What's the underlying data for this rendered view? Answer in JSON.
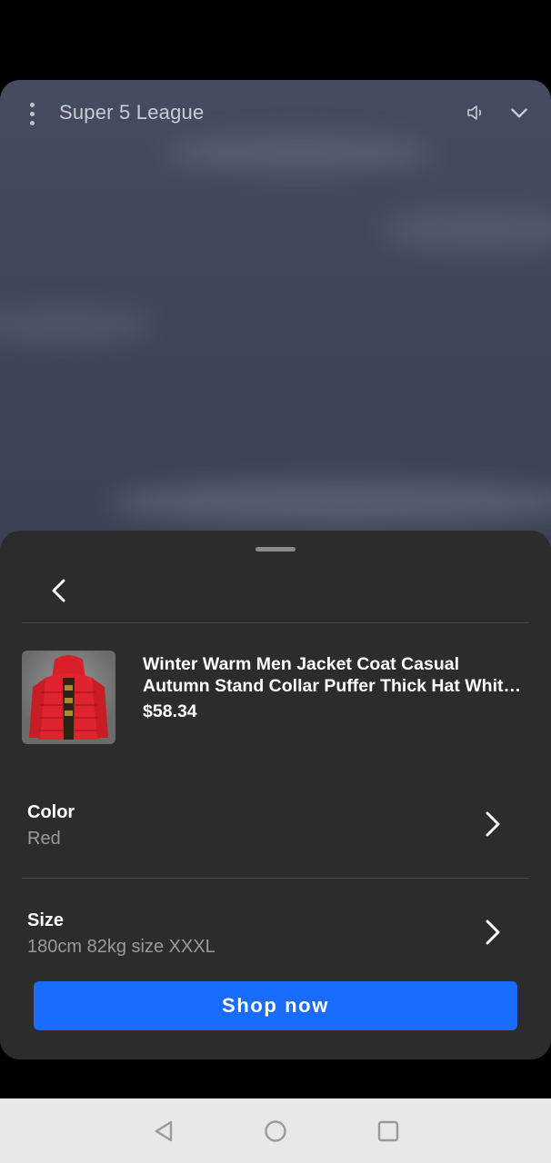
{
  "video": {
    "title": "Super 5 League",
    "icons": {
      "menu": "more-vert-icon",
      "volume": "volume-icon",
      "collapse": "chevron-down-icon"
    }
  },
  "sheet": {
    "back_icon": "chevron-left-icon",
    "product": {
      "title_line1": "Winter Warm Men Jacket Coat Casual",
      "title_line2": "Autumn Stand Collar Puffer Thick Hat Whit…",
      "price": "$58.34",
      "thumbnail": "red-puffer-jacket-image"
    },
    "options": [
      {
        "label": "Color",
        "value": "Red"
      },
      {
        "label": "Size",
        "value": "180cm 82kg size XXXL"
      }
    ],
    "cta_label": "Shop now",
    "colors": {
      "accent": "#1a6bff",
      "sheet_bg": "#2c2c2c"
    }
  },
  "system_nav": {
    "icons": [
      "back-triangle-icon",
      "home-circle-icon",
      "recents-square-icon"
    ]
  }
}
